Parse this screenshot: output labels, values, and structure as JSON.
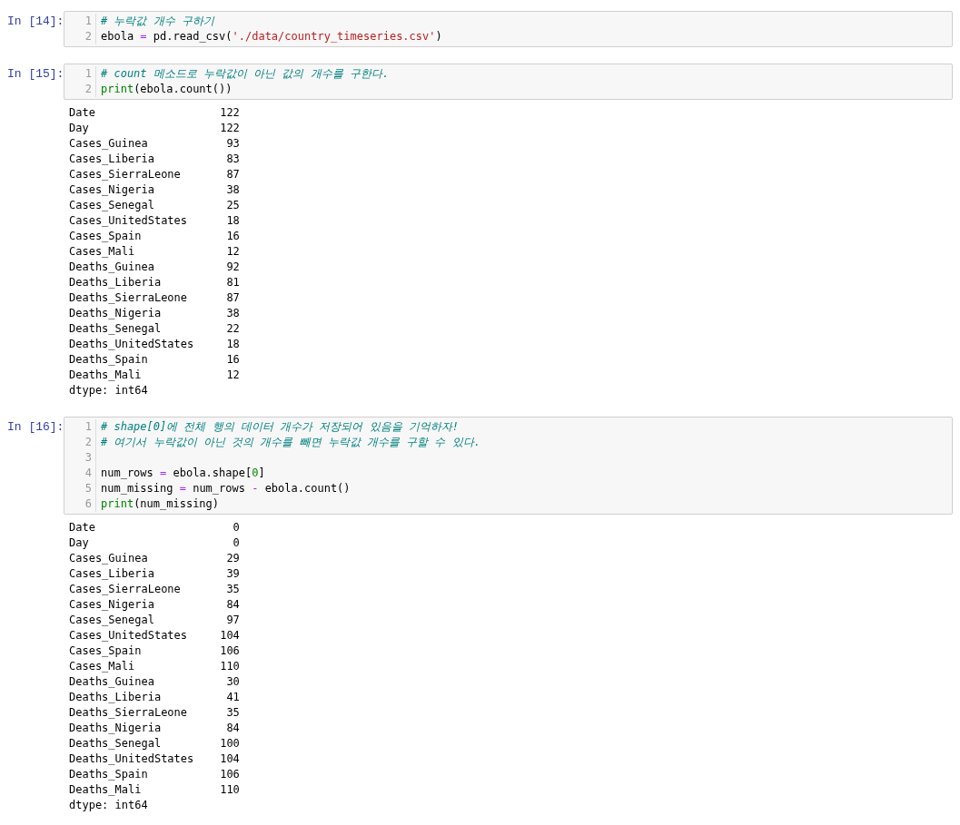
{
  "cells": [
    {
      "prompt": "In [14]:",
      "lines": [
        {
          "number": "1",
          "tokens": [
            {
              "text": "# 누락값 개수 구하기",
              "kind": "comment"
            }
          ]
        },
        {
          "number": "2",
          "tokens": [
            {
              "text": "ebola ",
              "kind": "plain"
            },
            {
              "text": "=",
              "kind": "operator"
            },
            {
              "text": " pd.read_csv(",
              "kind": "plain"
            },
            {
              "text": "'./data/country_timeseries.csv'",
              "kind": "string"
            },
            {
              "text": ")",
              "kind": "plain"
            }
          ]
        }
      ]
    },
    {
      "prompt": "In [15]:",
      "lines": [
        {
          "number": "1",
          "tokens": [
            {
              "text": "# count 메소드로 누락값이 아닌 값의 개수를 구한다.",
              "kind": "comment"
            }
          ]
        },
        {
          "number": "2",
          "tokens": [
            {
              "text": "print",
              "kind": "builtin"
            },
            {
              "text": "(ebola.count())",
              "kind": "plain"
            }
          ]
        }
      ],
      "output": [
        "Date                   122",
        "Day                    122",
        "Cases_Guinea            93",
        "Cases_Liberia           83",
        "Cases_SierraLeone       87",
        "Cases_Nigeria           38",
        "Cases_Senegal           25",
        "Cases_UnitedStates      18",
        "Cases_Spain             16",
        "Cases_Mali              12",
        "Deaths_Guinea           92",
        "Deaths_Liberia          81",
        "Deaths_SierraLeone      87",
        "Deaths_Nigeria          38",
        "Deaths_Senegal          22",
        "Deaths_UnitedStates     18",
        "Deaths_Spain            16",
        "Deaths_Mali             12",
        "dtype: int64"
      ]
    },
    {
      "prompt": "In [16]:",
      "lines": [
        {
          "number": "1",
          "tokens": [
            {
              "text": "# shape[0]에 전체 행의 데이터 개수가 저장되어 있음을 기억하자!",
              "kind": "comment"
            }
          ]
        },
        {
          "number": "2",
          "tokens": [
            {
              "text": "# 여기서 누락값이 아닌 것의 개수를 빼면 누락값 개수를 구할 수 있다.",
              "kind": "comment"
            }
          ]
        },
        {
          "number": "3"
        },
        {
          "number": "4",
          "tokens": [
            {
              "text": "num_rows ",
              "kind": "plain"
            },
            {
              "text": "=",
              "kind": "operator"
            },
            {
              "text": " ebola.shape[",
              "kind": "plain"
            },
            {
              "text": "0",
              "kind": "number"
            },
            {
              "text": "]",
              "kind": "plain"
            }
          ]
        },
        {
          "number": "5",
          "tokens": [
            {
              "text": "num_missing ",
              "kind": "plain"
            },
            {
              "text": "=",
              "kind": "operator"
            },
            {
              "text": " num_rows ",
              "kind": "plain"
            },
            {
              "text": "-",
              "kind": "operator"
            },
            {
              "text": " ebola.count()",
              "kind": "plain"
            }
          ]
        },
        {
          "number": "6",
          "tokens": [
            {
              "text": "print",
              "kind": "builtin"
            },
            {
              "text": "(num_missing)",
              "kind": "plain"
            }
          ]
        }
      ],
      "output": [
        "Date                     0",
        "Day                      0",
        "Cases_Guinea            29",
        "Cases_Liberia           39",
        "Cases_SierraLeone       35",
        "Cases_Nigeria           84",
        "Cases_Senegal           97",
        "Cases_UnitedStates     104",
        "Cases_Spain            106",
        "Cases_Mali             110",
        "Deaths_Guinea           30",
        "Deaths_Liberia          41",
        "Deaths_SierraLeone      35",
        "Deaths_Nigeria          84",
        "Deaths_Senegal         100",
        "Deaths_UnitedStates    104",
        "Deaths_Spain           106",
        "Deaths_Mali            110",
        "dtype: int64"
      ]
    }
  ]
}
